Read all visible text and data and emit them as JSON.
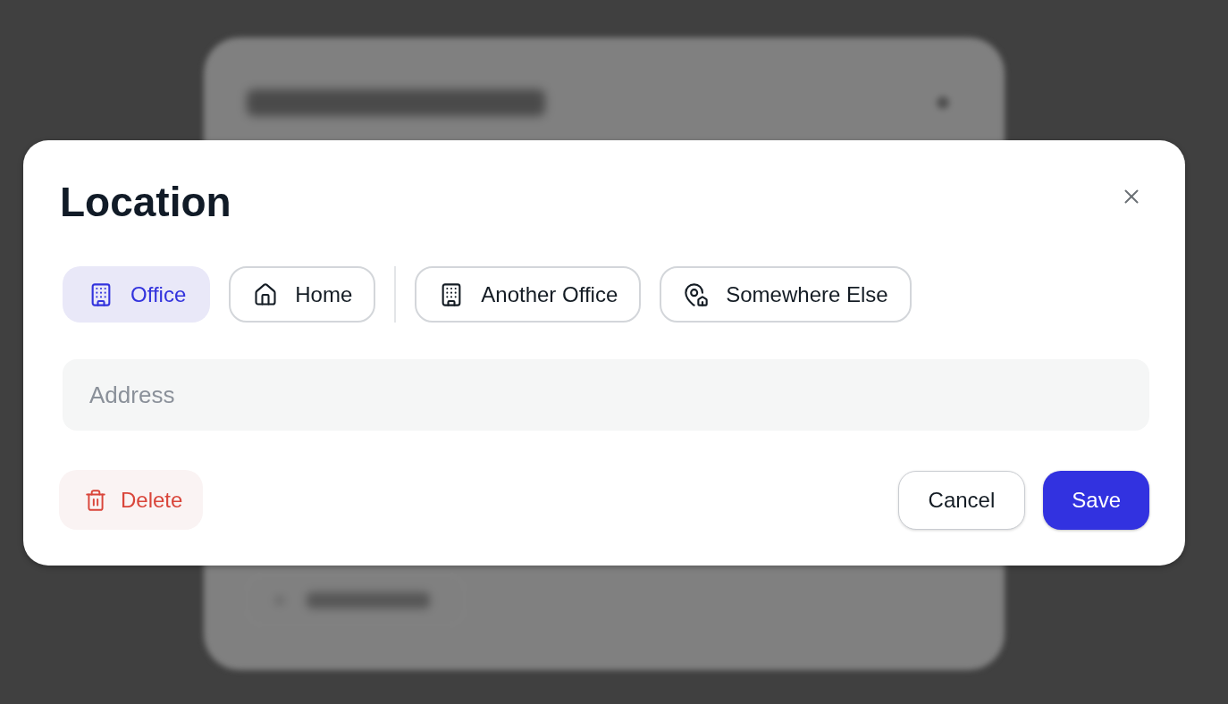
{
  "dialog": {
    "title": "Location",
    "location_groups": [
      [
        {
          "label": "Office",
          "kind": "building",
          "selected": true
        },
        {
          "label": "Home",
          "kind": "house",
          "selected": false
        }
      ],
      [
        {
          "label": "Another Office",
          "kind": "building",
          "selected": false
        },
        {
          "label": "Somewhere Else",
          "kind": "pin",
          "selected": false
        }
      ]
    ],
    "address": {
      "placeholder": "Address"
    },
    "buttons": [
      {
        "label": "Delete",
        "kind": "danger"
      },
      {
        "label": "Cancel",
        "kind": "secondary"
      },
      {
        "label": "Save",
        "kind": "primary"
      }
    ]
  }
}
